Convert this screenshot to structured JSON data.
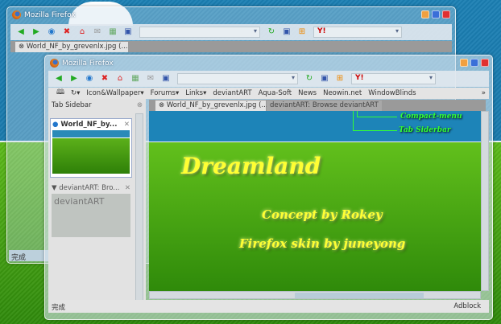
{
  "back_window": {
    "title": "Mozilla Firefox",
    "tab": "World_NF_by_grevenlx.jpg (...",
    "status": "完成"
  },
  "front_window": {
    "title": "Mozilla Firefox",
    "bookmarks": [
      "Icon&Wallpaper▾",
      "Forums▾",
      "Links▾",
      "deviantART",
      "Aqua-Soft",
      "News",
      "Neowin.net",
      "WindowBlinds"
    ],
    "chevron": "»",
    "tabs": [
      "World_NF_by_grevenlx.jpg (...",
      "deviantART: Browse deviantART"
    ],
    "sidebar": {
      "title": "Tab Sidebar",
      "items": [
        {
          "title": "World_NF_by..."
        },
        {
          "title": "deviantART: Bro..."
        }
      ],
      "thumb_logo": "deviantART"
    },
    "content": {
      "title": "Dreamland",
      "line1": "Concept by Rokey",
      "line2": "Firefox skin by juneyong",
      "note1": "Compact-menu",
      "note2": "Tab Siderbar"
    },
    "status": "完成",
    "adblock": "Adblock"
  },
  "colors": {
    "sky": "#1b7fb3",
    "grass": "#3f9a10",
    "glow": "#ffff33",
    "note": "#33ff33"
  }
}
